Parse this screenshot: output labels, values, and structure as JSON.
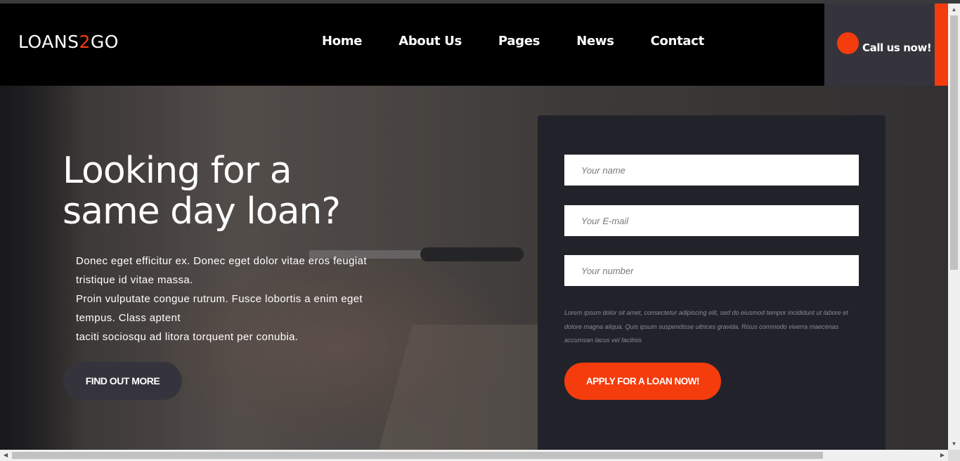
{
  "brand": {
    "prefix": "LOANS",
    "accent": "2",
    "suffix": "GO"
  },
  "nav": {
    "items": [
      "Home",
      "About Us",
      "Pages",
      "News",
      "Contact"
    ]
  },
  "call": {
    "label": "Call us now!"
  },
  "hero": {
    "headline_line1": "Looking for a",
    "headline_line2": "same day loan?",
    "lead": [
      "Donec eget efficitur ex. Donec eget dolor vitae eros feugiat tristique id vitae massa.",
      "Proin vulputate congue rutrum. Fusce lobortis a enim eget tempus. Class aptent",
      "taciti sociosqu ad litora torquent per conubia."
    ],
    "cta_label": "FIND OUT MORE"
  },
  "form": {
    "name_placeholder": "Your name",
    "email_placeholder": "Your E-mail",
    "number_placeholder": "Your number",
    "disclaimer": "Lorem ipsum dolor sit amet, consectetur adipiscing elit, sed do eiusmod tempor incididunt ut labore et dolore magna aliqua. Quis ipsum suspendisse ultrices gravida. Risus commodo viverra maecenas accumsan lacus vel facilisis",
    "apply_label": "APPLY FOR A LOAN NOW!"
  },
  "colors": {
    "accent": "#f53c0c",
    "header_bg": "#000000",
    "panel_bg": "#22232a",
    "dark_button": "#35343c"
  },
  "icons": {
    "call": "phone-circle-icon",
    "scroll_up": "arrow-up-icon",
    "scroll_down": "arrow-down-icon",
    "scroll_left": "arrow-left-icon",
    "scroll_right": "arrow-right-icon"
  }
}
